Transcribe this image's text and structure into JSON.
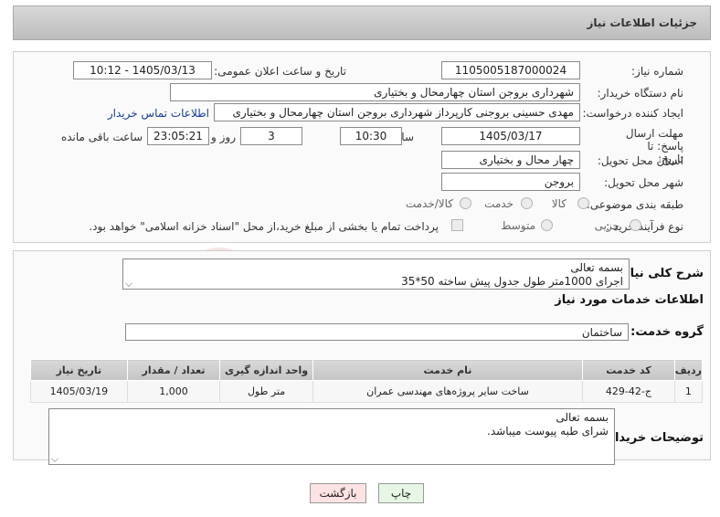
{
  "header": {
    "title": "جزئیات اطلاعات نیاز"
  },
  "form": {
    "need_number_label": "شماره نیاز:",
    "need_number": "1105005187000024",
    "announce_label": "تاریخ و ساعت اعلان عمومی:",
    "announce_value": "1405/03/13 - 10:12",
    "buyer_org_label": "نام دستگاه خریدار:",
    "buyer_org": "شهرداری بروجن استان چهارمحال و بختیاری",
    "creator_label": "ایجاد کننده درخواست:",
    "creator": "مهدی حسینی بروجنی کارپرداز شهرداری بروجن استان چهارمحال و بختیاری",
    "buyer_contact_link": "اطلاعات تماس خریدار",
    "deadline_label": "مهلت ارسال پاسخ: تا تاریخ:",
    "deadline_date": "1405/03/17",
    "time_label": "ساعت",
    "deadline_time": "10:30",
    "days_value": "3",
    "days_label": "روز و",
    "remaining_time": "23:05:21",
    "remaining_label": "ساعت باقی مانده",
    "province_label": "استان محل تحویل:",
    "province": "چهار محال و بختیاری",
    "city_label": "شهر محل تحویل:",
    "city": "بروجن",
    "category_label": "طبقه بندی موضوعی:",
    "category_options": [
      "کالا",
      "خدمت",
      "کالا/خدمت"
    ],
    "purchase_type_label": "نوع فرآیند خرید :",
    "purchase_options": [
      "جزیی",
      "متوسط"
    ],
    "payment_note": "پرداخت تمام یا بخشی از مبلغ خرید،از محل \"اسناد خزانه اسلامی\" خواهد بود."
  },
  "description": {
    "label": "شرح کلی نیاز:",
    "line1": "بسمه تعالی",
    "line2": "اجرای 1000متر طول جدول پیش ساخته 50*35"
  },
  "services": {
    "section_title": "اطلاعات خدمات مورد نیاز",
    "group_label": "گروه خدمت:",
    "group_value": "ساختمان",
    "columns": [
      "ردیف",
      "کد خدمت",
      "نام خدمت",
      "واحد اندازه گیری",
      "تعداد / مقدار",
      "تاریخ نیاز"
    ],
    "rows": [
      [
        "1",
        "ج-42-429",
        "ساخت سایر پروژه‌های مهندسی عمران",
        "متر طول",
        "1,000",
        "1405/03/19"
      ]
    ]
  },
  "buyer_notes": {
    "label": "توضیحات خریدار:",
    "line1": "بسمه تعالی",
    "line2": "شرای طبه پیوست میباشد."
  },
  "buttons": {
    "print": "چاپ",
    "back": "بازگشت"
  },
  "colors": {
    "back_button_bg": "#fde3e3",
    "print_button_bg": "#e6f7e6",
    "watermark": "#c0392b"
  }
}
